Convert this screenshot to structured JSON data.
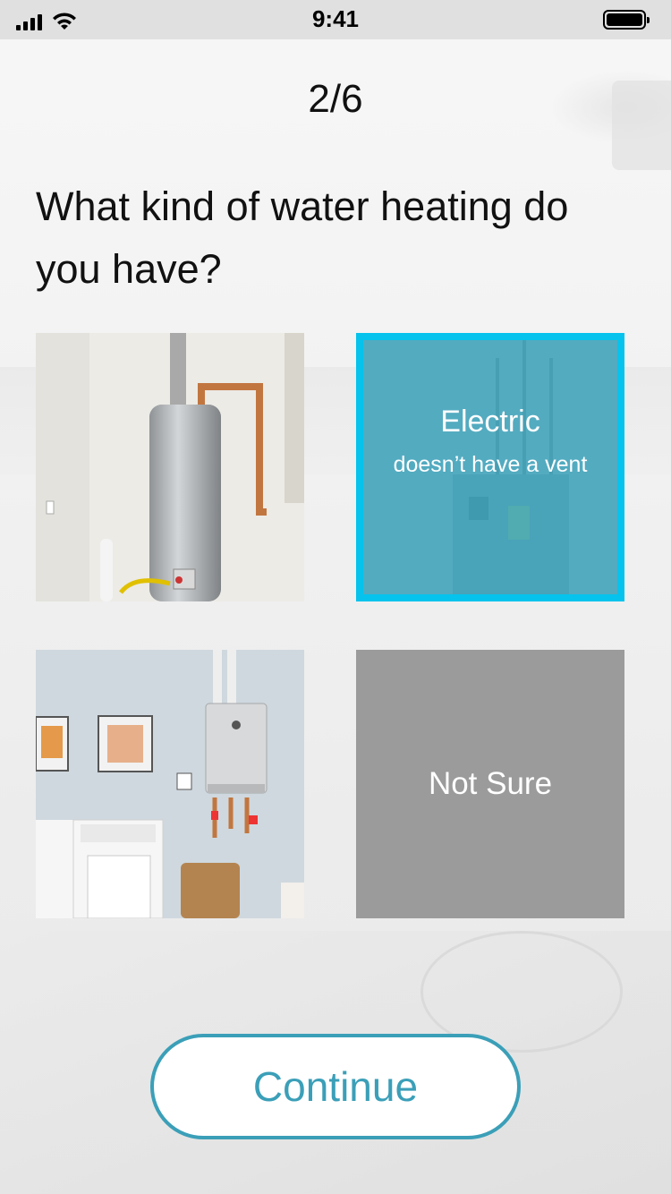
{
  "status_bar": {
    "time": "9:41"
  },
  "progress": {
    "label": "2/6"
  },
  "question": {
    "text": "What kind of water heating do you have?"
  },
  "options": [
    {
      "id": "tank",
      "image": "tank-water-heater"
    },
    {
      "id": "electric",
      "title": "Electric",
      "subtitle": "doesn’t have a vent",
      "selected": true
    },
    {
      "id": "tankless",
      "image": "tankless-water-heater"
    },
    {
      "id": "not-sure",
      "title": "Not Sure"
    }
  ],
  "continue_button": {
    "label": "Continue"
  },
  "colors": {
    "accent": "#05c3ec",
    "button": "#3b9fb8",
    "selected_overlay": "#42a6be",
    "not_sure_bg": "#9b9b9b"
  }
}
